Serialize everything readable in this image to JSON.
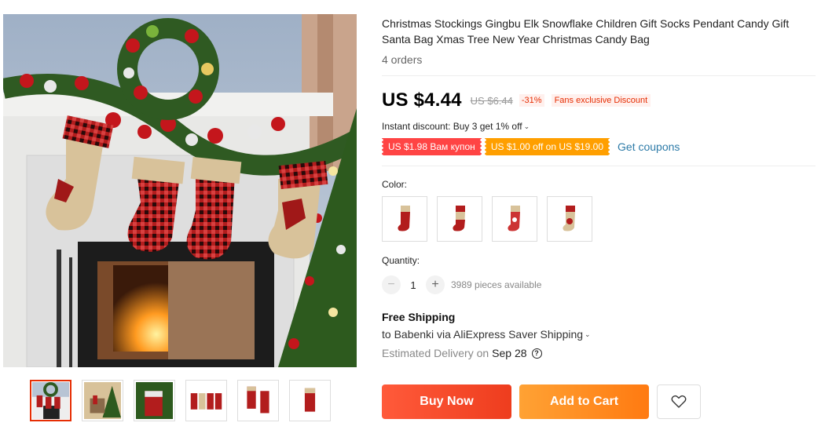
{
  "product": {
    "title": "Christmas Stockings Gingbu Elk Snowflake Children Gift Socks Pendant Candy Gift Santa Bag Xmas Tree New Year Christmas Candy Bag",
    "orders": "4 orders"
  },
  "pricing": {
    "current": "US $4.44",
    "original": "US $6.44",
    "discount": "-31%",
    "fans_badge": "Fans exclusive Discount",
    "instant_discount": "Instant discount: Buy 3 get 1% off",
    "coupon_1": "US $1.98 Вам купон",
    "coupon_2": "US $1.00 off on US $19.00",
    "get_coupons": "Get coupons"
  },
  "color": {
    "label": "Color:",
    "options_count": 4
  },
  "quantity": {
    "label": "Quantity:",
    "value": "1",
    "minus": "−",
    "plus": "+",
    "available": "3989 pieces available"
  },
  "shipping": {
    "title": "Free Shipping",
    "to": "to Babenki via AliExpress Saver Shipping",
    "estimated_label": "Estimated Delivery on",
    "date": "Sep 28",
    "help_glyph": "?"
  },
  "actions": {
    "buy_now": "Buy Now",
    "add_to_cart": "Add to Cart"
  },
  "icons": {
    "wishlist": "heart-icon",
    "dropdown": "chevron-down-icon",
    "help": "question-circle-icon"
  },
  "colors": {
    "accent_red": "#e62e04",
    "buy_button": "#f44a2a",
    "cart_button": "#ff8d1f",
    "coupon_red": "#ff4444",
    "coupon_orange": "#ff9f00",
    "link_blue": "#2d7ba8"
  }
}
